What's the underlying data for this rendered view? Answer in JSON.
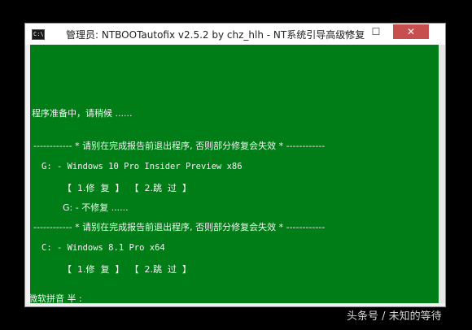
{
  "window": {
    "title": "管理员:  NTBOOTautofix v2.5.2 by chz_hlh - NT系统引导高级修复",
    "icon_label": "C:\\",
    "controls": {
      "minimize": "—",
      "maximize": "☐",
      "close": "✕"
    }
  },
  "console": {
    "preparing": "程序准备中，请稍候 ......",
    "warning_1": "------------ * 请别在完成报告前退出程序, 否则部分修复会失效 * ------------",
    "entry_1": {
      "os": "G: - Windows 10 Pro Insider Preview x86",
      "options": "【  1.修  复  】  【  2.跳  过  】",
      "status": "G: - 不修复 ......"
    },
    "warning_2": "------------ * 请别在完成报告前退出程序, 否则部分修复会失效 * ------------",
    "entry_2": {
      "os": "C: - Windows 8.1 Pro x64",
      "options": "【  1.修  复  】  【  2.跳  过  】"
    },
    "ime": "微软拼音 半 :"
  },
  "watermark": "头条号 / 未知的等待",
  "colors": {
    "console_bg": "#007d16",
    "console_fg": "#f4f4f4",
    "close_btn": "#c7504f"
  }
}
